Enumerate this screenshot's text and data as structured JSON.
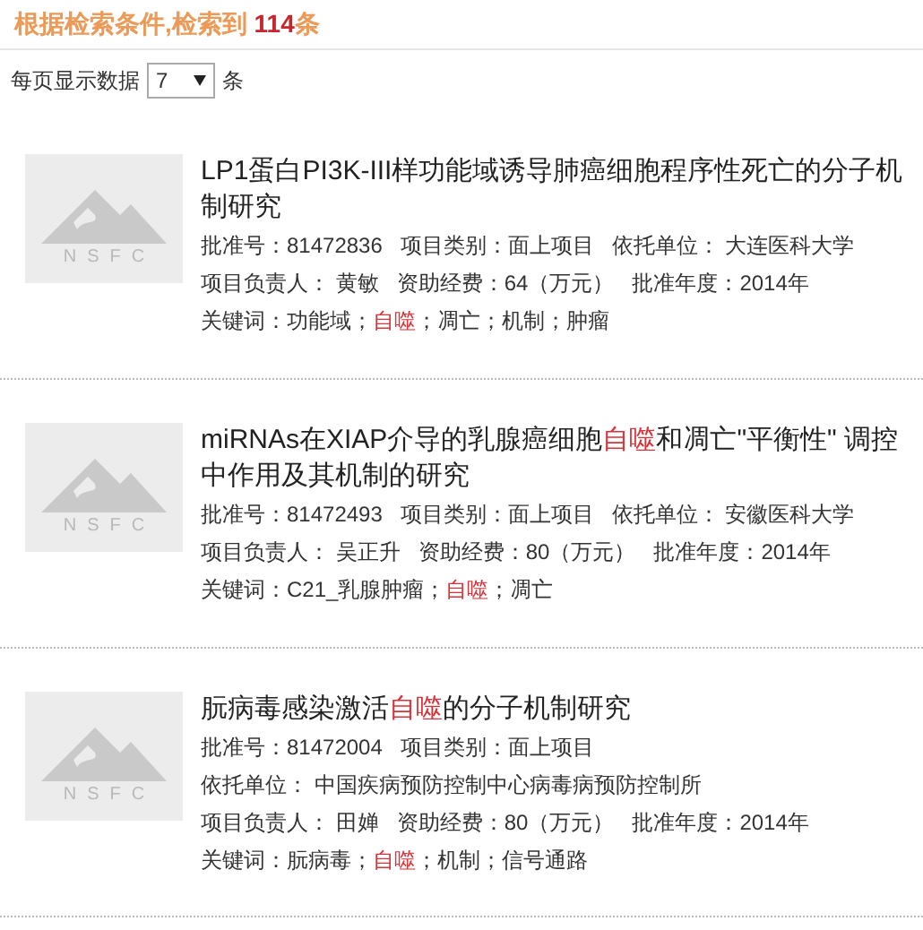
{
  "summary": {
    "text": "根据检索条件,检索到 ",
    "count": "114",
    "unit": "条"
  },
  "page_size": {
    "label": "每页显示数据",
    "value": "7",
    "unit": "条"
  },
  "results": [
    {
      "logo": "NSFC",
      "title": [
        {
          "text": "LP1蛋白PI3K-III样功能域诱导肺癌细胞程序性死亡的分子机制研究",
          "highlight": false
        }
      ],
      "lines": [
        [
          "批准号：81472836",
          "项目类别：面上项目",
          "依托单位： 大连医科大学"
        ],
        [
          "项目负责人： 黄敏",
          "资助经费：64（万元）",
          "批准年度：2014年"
        ]
      ],
      "keywords": [
        {
          "text": "关键词：功能域；",
          "highlight": false
        },
        {
          "text": "自噬",
          "highlight": true
        },
        {
          "text": "；凋亡；机制；肿瘤",
          "highlight": false
        }
      ]
    },
    {
      "logo": "NSFC",
      "title": [
        {
          "text": "miRNAs在XIAP介导的乳腺癌细胞",
          "highlight": false
        },
        {
          "text": "自噬",
          "highlight": true
        },
        {
          "text": "和凋亡\"平衡性\" 调控中作用及其机制的研究",
          "highlight": false
        }
      ],
      "lines": [
        [
          "批准号：81472493",
          "项目类别：面上项目",
          "依托单位： 安徽医科大学"
        ],
        [
          "项目负责人： 吴正升",
          "资助经费：80（万元）",
          "批准年度：2014年"
        ]
      ],
      "keywords": [
        {
          "text": "关键词：C21_乳腺肿瘤；",
          "highlight": false
        },
        {
          "text": "自噬",
          "highlight": true
        },
        {
          "text": "；凋亡",
          "highlight": false
        }
      ]
    },
    {
      "logo": "NSFC",
      "title": [
        {
          "text": "朊病毒感染激活",
          "highlight": false
        },
        {
          "text": "自噬",
          "highlight": true
        },
        {
          "text": "的分子机制研究",
          "highlight": false
        }
      ],
      "lines": [
        [
          "批准号：81472004",
          "项目类别：面上项目"
        ],
        [
          "依托单位： 中国疾病预防控制中心病毒病预防控制所"
        ],
        [
          "项目负责人： 田婵",
          "资助经费：80（万元）",
          "批准年度：2014年"
        ]
      ],
      "keywords": [
        {
          "text": "关键词：朊病毒；",
          "highlight": false
        },
        {
          "text": "自噬",
          "highlight": true
        },
        {
          "text": "；机制；信号通路",
          "highlight": false
        }
      ]
    }
  ]
}
